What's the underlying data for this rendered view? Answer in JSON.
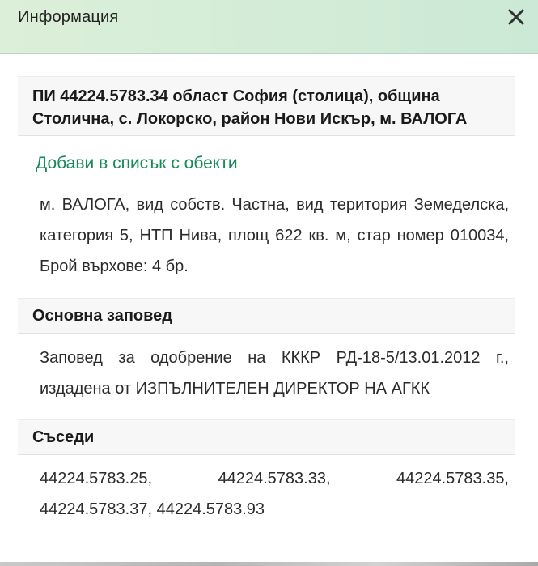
{
  "header": {
    "title": "Информация"
  },
  "property": {
    "title_line1": "ПИ 44224.5783.34 област София (столица), община",
    "title_line2": "Столична, с. Локорско, район Нови Искър, м. ВАЛОГА",
    "add_link": "Добави в списък с обекти",
    "description": "м. ВАЛОГА, вид собств. Частна, вид територия Земеделска, категория 5, НТП Нива, площ 622 кв. м, стар номер 010034, Брой върхове: 4 бр."
  },
  "order": {
    "heading": "Основна заповед",
    "text": "Заповед за одобрение на КККР РД-18-5/13.01.2012 г., издадена от ИЗПЪЛНИТЕЛЕН ДИРЕКТОР НА АГКК"
  },
  "neighbors": {
    "heading": "Съседи",
    "items": [
      "44224.5783.25,",
      "44224.5783.33,",
      "44224.5783.35,",
      "44224.5783.37, 44224.5783.93"
    ]
  },
  "icons": {
    "close": "close-icon"
  },
  "colors": {
    "header_bg": "#d3ecd7",
    "link": "#168a57",
    "section_bg": "#f7f7f7"
  }
}
